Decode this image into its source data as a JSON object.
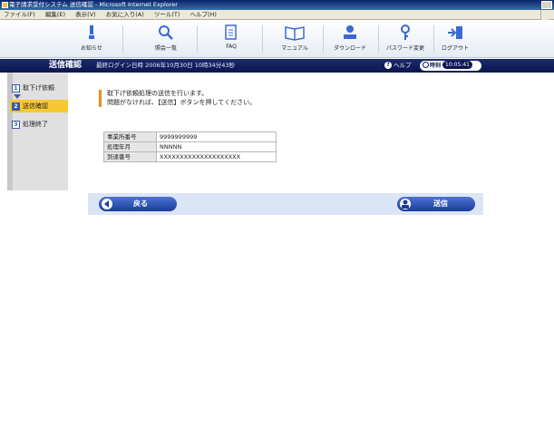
{
  "window": {
    "title": "電子請求受付システム 送信確認 - Microsoft Internet Explorer"
  },
  "menu": [
    "ファイル(F)",
    "編集(E)",
    "表示(V)",
    "お気に入り(A)",
    "ツール(T)",
    "ヘルプ(H)"
  ],
  "toolbar": [
    {
      "label": "お知らせ",
      "icon": "notice-icon"
    },
    {
      "label": "照会一覧",
      "icon": "search-icon"
    },
    {
      "label": "FAQ",
      "icon": "faq-icon"
    },
    {
      "label": "マニュアル",
      "icon": "manual-icon"
    },
    {
      "label": "ダウンロード",
      "icon": "download-icon"
    },
    {
      "label": "パスワード変更",
      "icon": "password-icon"
    },
    {
      "label": "ログアウト",
      "icon": "logout-icon"
    }
  ],
  "header": {
    "title": "送信確認",
    "last_login": "最終ログイン日時 2006年10月30日 10時34分43秒",
    "help": "ヘルプ",
    "clock_label": "時刻",
    "clock_time": "10:05:41"
  },
  "steps": [
    {
      "num": "1",
      "label": "取下げ依頼"
    },
    {
      "num": "2",
      "label": "送信確認"
    },
    {
      "num": "3",
      "label": "処理終了"
    }
  ],
  "message": {
    "line1": "取下げ依頼処理の送信を行います。",
    "line2": "問題がなければ、【送信】ボタンを押してください。"
  },
  "info": [
    {
      "key": "事業所番号",
      "value": "9999999999"
    },
    {
      "key": "処理年月",
      "value": "NNNNN"
    },
    {
      "key": "到達番号",
      "value": "XXXXXXXXXXXXXXXXXXXX"
    }
  ],
  "buttons": {
    "back": "戻る",
    "send": "送信"
  },
  "colors": {
    "header_band": "#0c1650",
    "active_step": "#f7c830",
    "accent_bar": "#f08c1e",
    "button": "#1a3c9a"
  }
}
